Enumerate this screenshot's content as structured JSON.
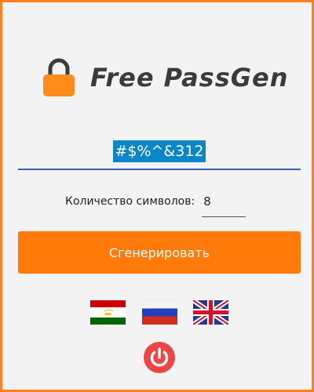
{
  "app": {
    "title": "Free PassGen"
  },
  "password": {
    "value": "#$%^&312"
  },
  "length": {
    "label": "Количество символов:",
    "value": "8"
  },
  "generate_button": {
    "label": "Сгенерировать"
  },
  "languages": [
    {
      "icon": "flag-tajikistan-icon"
    },
    {
      "icon": "flag-russia-icon"
    },
    {
      "icon": "flag-uk-icon"
    }
  ],
  "power_button": {
    "icon": "power-icon"
  },
  "colors": {
    "accent": "#ff7a08",
    "border": "#ff7f1f",
    "selection": "#0a86c9",
    "underline": "#3a5fa8",
    "power": "#ee4444"
  }
}
